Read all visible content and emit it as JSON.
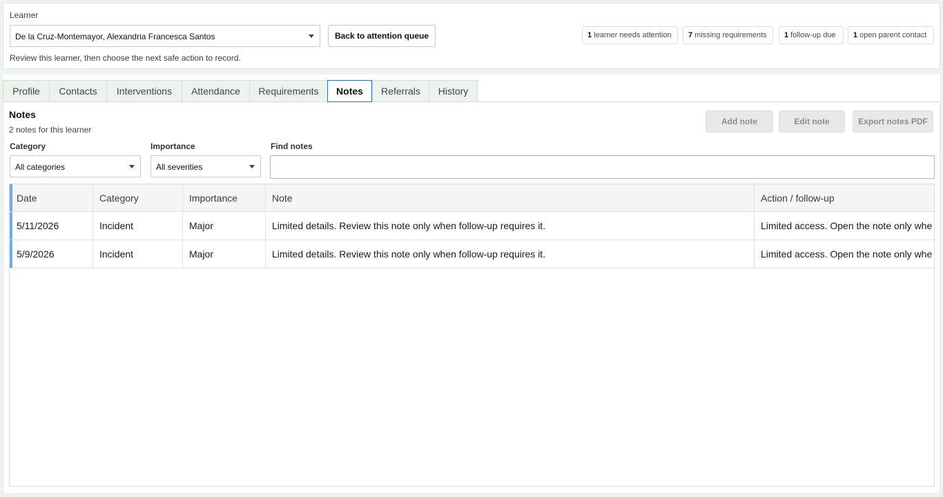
{
  "learner": {
    "label": "Learner",
    "selected": "De la Cruz-Montemayor, Alexandria Francesca Santos",
    "back_button": "Back to attention queue",
    "instruction": "Review this learner, then choose the next safe action to record."
  },
  "stats": [
    {
      "count": "1",
      "label": "learner needs attention"
    },
    {
      "count": "7",
      "label": "missing requirements"
    },
    {
      "count": "1",
      "label": "follow-up due"
    },
    {
      "count": "1",
      "label": "open parent contact"
    }
  ],
  "tabs": [
    "Profile",
    "Contacts",
    "Interventions",
    "Attendance",
    "Requirements",
    "Notes",
    "Referrals",
    "History"
  ],
  "active_tab": "Notes",
  "notes": {
    "title": "Notes",
    "count_text": "2 notes for this learner",
    "buttons": {
      "add": "Add note",
      "edit": "Edit note",
      "export": "Export notes PDF"
    },
    "filters": {
      "category_label": "Category",
      "category_value": "All categories",
      "importance_label": "Importance",
      "importance_value": "All severities",
      "find_label": "Find notes",
      "find_value": ""
    },
    "columns": [
      "Date",
      "Category",
      "Importance",
      "Note",
      "Action / follow-up"
    ],
    "rows": [
      {
        "date": "5/11/2026",
        "category": "Incident",
        "importance": "Major",
        "note": "Limited details. Review this note only when follow-up requires it.",
        "action": "Limited access. Open the note only whe"
      },
      {
        "date": "5/9/2026",
        "category": "Incident",
        "importance": "Major",
        "note": "Limited details. Review this note only when follow-up requires it.",
        "action": "Limited access. Open the note only whe"
      }
    ]
  },
  "colors": {
    "accent": "#2f6fb3",
    "row_marker": "#6cb0e6",
    "page_bg": "#eef3ee"
  }
}
